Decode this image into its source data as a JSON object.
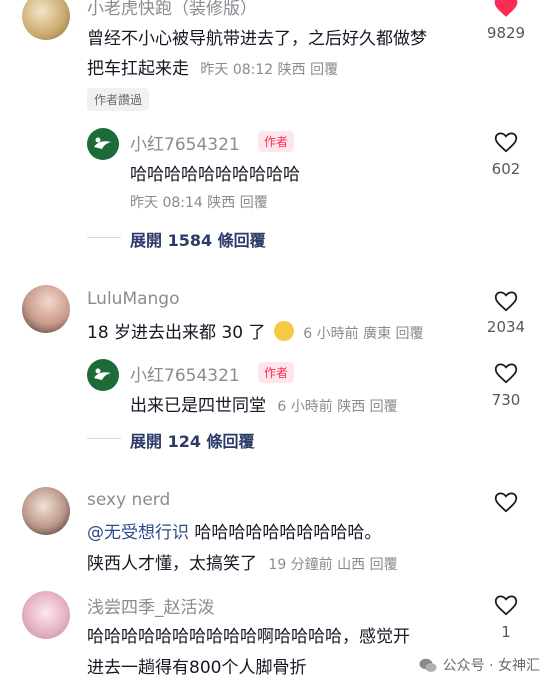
{
  "comments": [
    {
      "username": "小老虎快跑（装修版）",
      "text_line1": "曾经不小心被导航带进去了，之后好久都做梦",
      "text_line2": "把车扛起来走",
      "meta": "昨天 08:12 陕西 回覆",
      "likes": "9829",
      "tag": "作者讚過",
      "reply": {
        "username": "小红7654321",
        "badge": "作者",
        "text": "哈哈哈哈哈哈哈哈哈哈",
        "meta": "昨天 08:14 陕西 回覆",
        "likes": "602"
      },
      "expand": "展開 1584 條回覆"
    },
    {
      "username": "LuluMango",
      "text": "18 岁进去出来都 30 了",
      "meta": "6 小時前 廣東 回覆",
      "likes": "2034",
      "reply": {
        "username": "小红7654321",
        "badge": "作者",
        "text": "出来已是四世同堂",
        "meta": "6 小時前 陕西 回覆",
        "likes": "730"
      },
      "expand": "展開 124 條回覆"
    },
    {
      "username": "sexy nerd",
      "mention": "@无受想行识",
      "text_line1_rest": " 哈哈哈哈哈哈哈哈哈哈。",
      "text_line2": "陕西人才懂，太搞笑了",
      "meta": "19 分鐘前 山西 回覆"
    },
    {
      "username": "浅尝四季_赵活泼",
      "text_line1": "哈哈哈哈哈哈哈哈哈哈啊哈哈哈哈，感觉开",
      "text_line2": "进去一趟得有800个人脚骨折",
      "likes": "1"
    }
  ],
  "watermark": "公众号 · 女神汇",
  "colors": {
    "accent": "#fe2c55",
    "muted": "#8a8b91",
    "text": "#161823",
    "link": "#2b3a67"
  }
}
